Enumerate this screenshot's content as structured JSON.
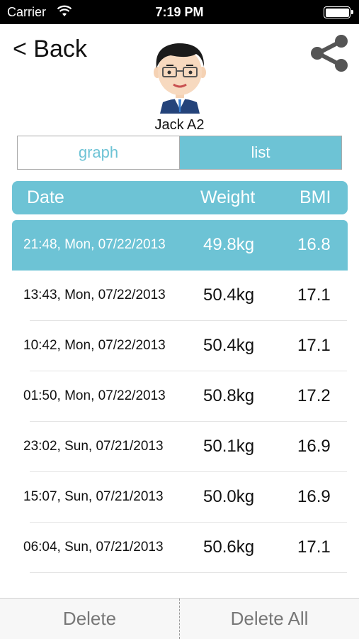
{
  "status_bar": {
    "carrier": "Carrier",
    "time": "7:19 PM",
    "wifi_icon": "wifi-icon",
    "battery_icon": "battery-icon"
  },
  "nav": {
    "back_label": "< Back",
    "share_icon": "share-icon"
  },
  "profile": {
    "name": "Jack A2",
    "avatar_icon": "avatar-icon"
  },
  "segments": {
    "graph_label": "graph",
    "list_label": "list",
    "selected": "list"
  },
  "table": {
    "headers": {
      "date": "Date",
      "weight": "Weight",
      "bmi": "BMI"
    },
    "rows": [
      {
        "date": "21:48, Mon, 07/22/2013",
        "weight": "49.8kg",
        "bmi": "16.8",
        "selected": true
      },
      {
        "date": "13:43, Mon, 07/22/2013",
        "weight": "50.4kg",
        "bmi": "17.1"
      },
      {
        "date": "10:42, Mon, 07/22/2013",
        "weight": "50.4kg",
        "bmi": "17.1"
      },
      {
        "date": "01:50, Mon, 07/22/2013",
        "weight": "50.8kg",
        "bmi": "17.2"
      },
      {
        "date": "23:02, Sun, 07/21/2013",
        "weight": "50.1kg",
        "bmi": "16.9"
      },
      {
        "date": "15:07, Sun, 07/21/2013",
        "weight": "50.0kg",
        "bmi": "16.9"
      },
      {
        "date": "06:04, Sun, 07/21/2013",
        "weight": "50.6kg",
        "bmi": "17.1"
      }
    ]
  },
  "bottom_bar": {
    "delete_label": "Delete",
    "delete_all_label": "Delete All"
  },
  "colors": {
    "accent": "#6dc3d5",
    "text": "#111111",
    "muted": "#777777"
  }
}
